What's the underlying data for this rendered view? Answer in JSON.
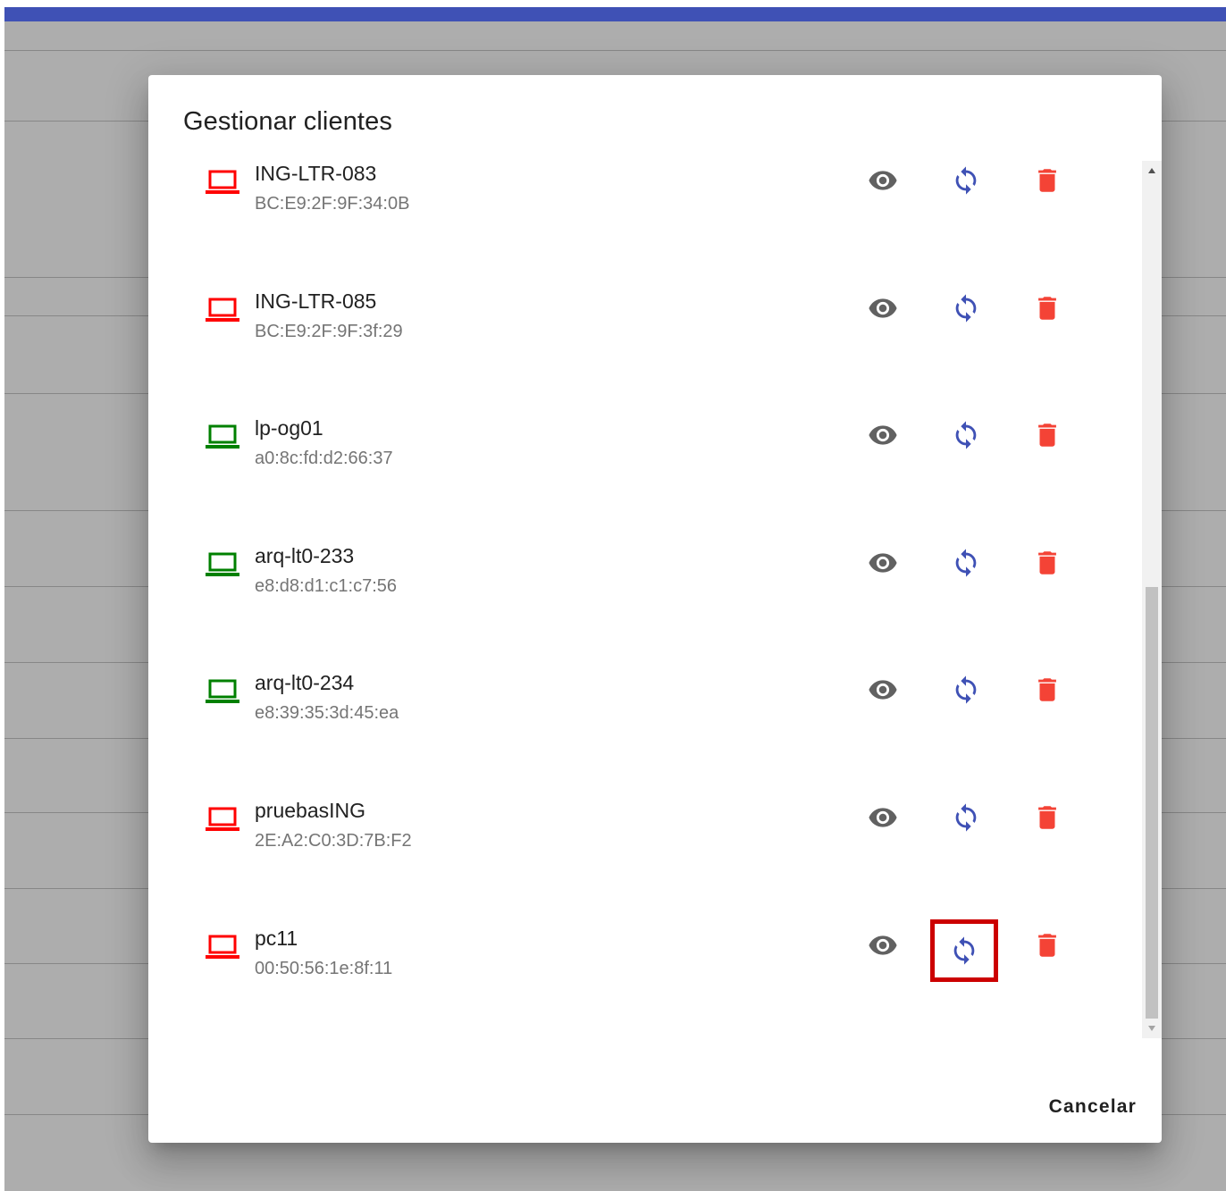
{
  "dialog": {
    "title": "Gestionar clientes",
    "cancel_label": "Cancelar"
  },
  "colors": {
    "online": "#008000",
    "offline": "#ff0000",
    "view_icon": "#616161",
    "sync_icon": "#3f51b5",
    "delete_icon": "#f44336",
    "highlight": "#cc0000",
    "top_bar": "#3f51b5"
  },
  "clients": [
    {
      "name": "ING-LTR-083",
      "mac": "BC:E9:2F:9F:34:0B",
      "status": "offline",
      "icon": "laptop-icon"
    },
    {
      "name": "ING-LTR-085",
      "mac": "BC:E9:2F:9F:3f:29",
      "status": "offline",
      "icon": "laptop-icon"
    },
    {
      "name": "lp-og01",
      "mac": "a0:8c:fd:d2:66:37",
      "status": "online",
      "icon": "laptop-icon"
    },
    {
      "name": "arq-lt0-233",
      "mac": "e8:d8:d1:c1:c7:56",
      "status": "online",
      "icon": "laptop-icon"
    },
    {
      "name": "arq-lt0-234",
      "mac": "e8:39:35:3d:45:ea",
      "status": "online",
      "icon": "laptop-icon"
    },
    {
      "name": "pruebasING",
      "mac": "2E:A2:C0:3D:7B:F2",
      "status": "offline",
      "icon": "laptop-icon"
    },
    {
      "name": "pc11",
      "mac": "00:50:56:1e:8f:11",
      "status": "offline",
      "icon": "laptop-icon",
      "highlighted_action": "sync"
    }
  ],
  "row_actions": [
    "eye-icon",
    "sync-icon",
    "delete-icon"
  ]
}
